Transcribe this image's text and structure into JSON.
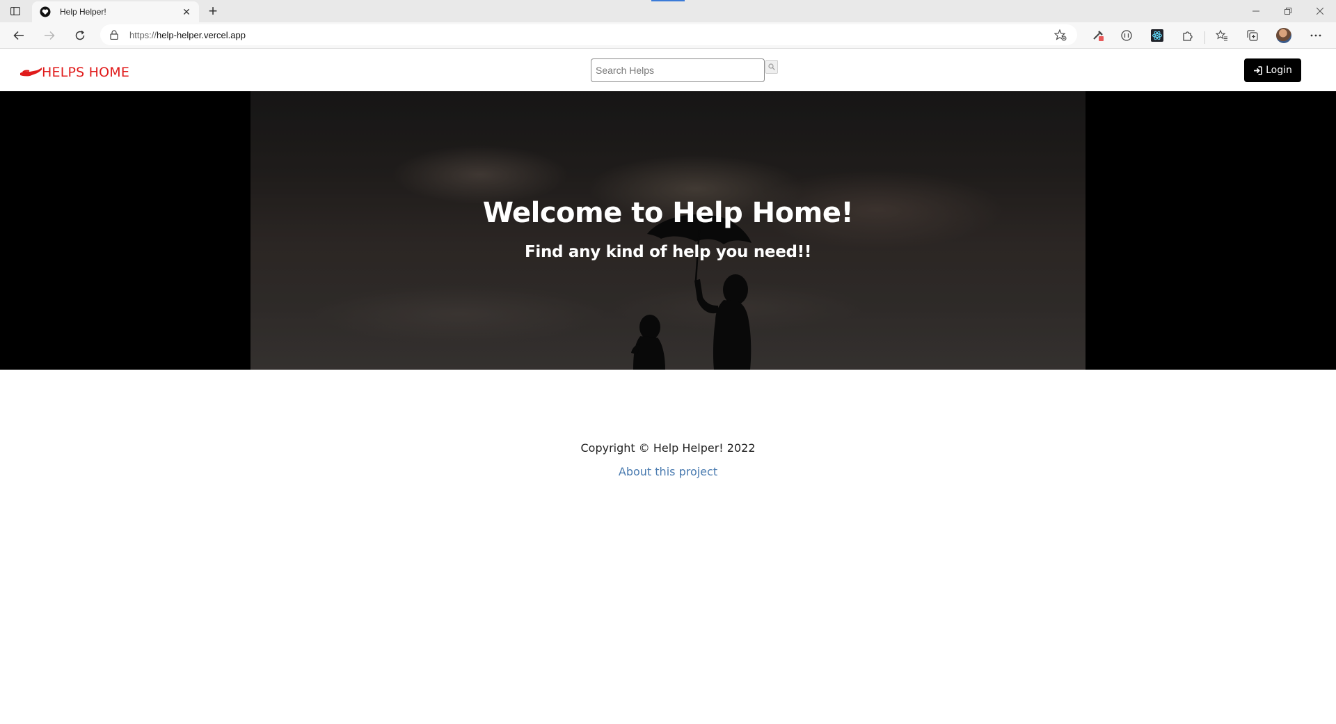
{
  "browser": {
    "tab_title": "Help Helper!",
    "url_prefix": "https://",
    "url_host": "help-helper.vercel.app"
  },
  "site": {
    "brand": "HELPS HOME",
    "search_placeholder": "Search Helps",
    "login_label": "Login",
    "brand_color": "#e01b1b"
  },
  "hero": {
    "title": "Welcome to Help Home!",
    "subtitle": "Find any kind of help you need!!"
  },
  "footer": {
    "copyright": "Copyright © Help Helper! 2022",
    "about_link": "About this project",
    "link_color": "#4a7bb0"
  },
  "icons": [
    "sidebar-toggle-icon",
    "heart-shield-favicon-icon",
    "close-icon",
    "plus-icon",
    "back-arrow-icon",
    "forward-arrow-icon",
    "refresh-icon",
    "lock-icon",
    "add-favorite-icon",
    "extension-icons",
    "favorites-icon",
    "collections-icon",
    "more-icon",
    "hand-icon",
    "search-icon",
    "login-icon"
  ]
}
